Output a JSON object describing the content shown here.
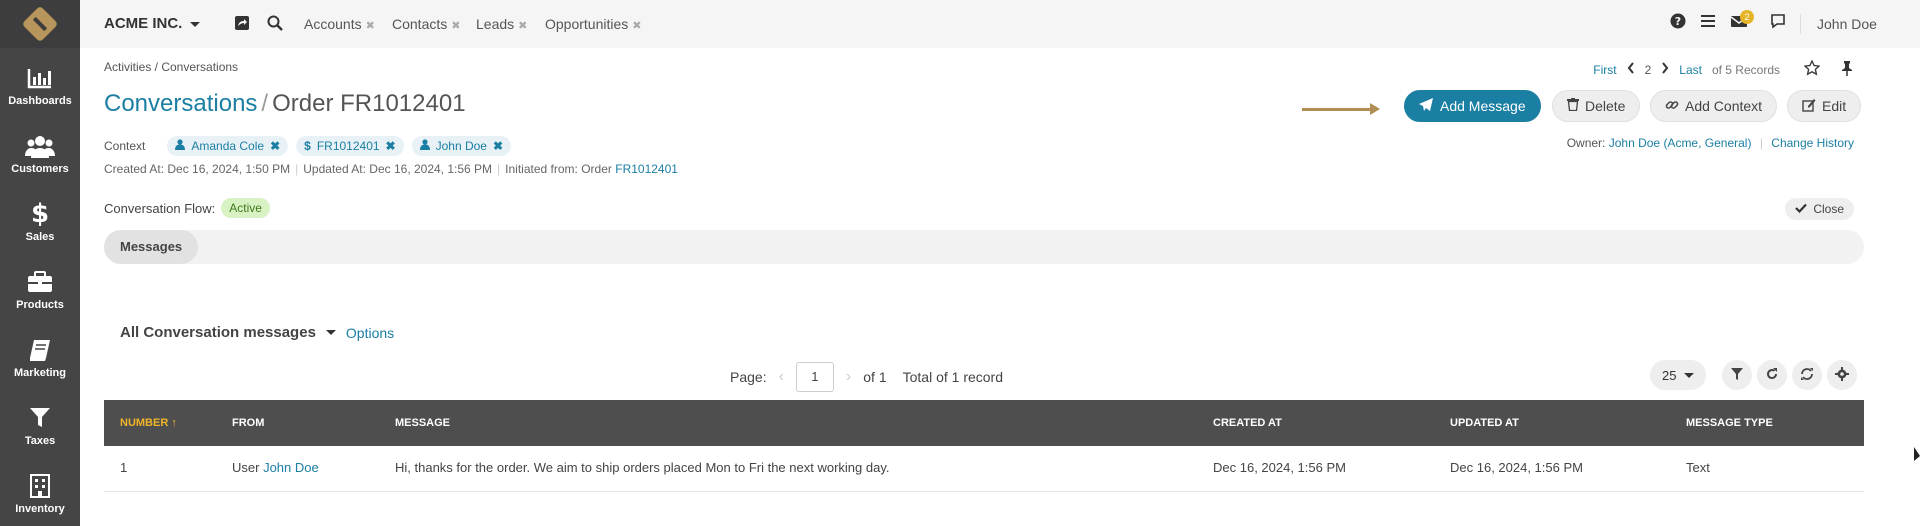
{
  "colors": {
    "accent": "#1b7fa3",
    "sidebar": "#454545",
    "badge": "#e5b427",
    "active_status": "#d9f2c4",
    "table_header": "#4e4e4e",
    "sort_highlight": "#f0b429"
  },
  "topbar": {
    "org_name": "ACME INC.",
    "tabs": [
      {
        "label": "Accounts"
      },
      {
        "label": "Contacts"
      },
      {
        "label": "Leads"
      },
      {
        "label": "Opportunities"
      }
    ],
    "tab_close": "✖",
    "notifications_count": "2",
    "user_name": "John Doe"
  },
  "sidebar": {
    "items": [
      {
        "label": "Dashboards",
        "icon": "bar-chart-icon"
      },
      {
        "label": "Customers",
        "icon": "users-icon"
      },
      {
        "label": "Sales",
        "icon": "dollar-icon"
      },
      {
        "label": "Products",
        "icon": "briefcase-icon"
      },
      {
        "label": "Marketing",
        "icon": "book-icon"
      },
      {
        "label": "Taxes",
        "icon": "filter-icon"
      },
      {
        "label": "Inventory",
        "icon": "building-icon"
      }
    ]
  },
  "page": {
    "breadcrumb": "Activities / Conversations",
    "title_parent": "Conversations",
    "title_separator": "/",
    "title_record": "Order FR1012401",
    "pager": {
      "first": "First",
      "current": "2",
      "last": "Last",
      "summary": "of 5 Records"
    },
    "actions": {
      "add_message": "Add Message",
      "delete": "Delete",
      "add_context": "Add Context",
      "edit": "Edit"
    },
    "context_label": "Context",
    "context_items": [
      {
        "label": "Amanda Cole",
        "icon": "user-icon"
      },
      {
        "label": "FR1012401",
        "icon": "dollar-icon"
      },
      {
        "label": "John Doe",
        "icon": "user-icon"
      }
    ],
    "owner_label": "Owner:",
    "owner_value": "John Doe (Acme, General)",
    "change_history": "Change History",
    "created_at": "Created At: Dec 16, 2024, 1:50 PM",
    "updated_at": "Updated At: Dec 16, 2024, 1:56 PM",
    "initiated_label": "Initiated from: Order",
    "initiated_link": "FR1012401",
    "flow_label": "Conversation Flow:",
    "flow_status": "Active",
    "close_label": "Close",
    "tab_messages": "Messages"
  },
  "grid": {
    "title": "All Conversation messages",
    "options": "Options",
    "page_label": "Page:",
    "page_value": "1",
    "of_pages": "of 1",
    "total": "Total of 1 record",
    "per_page": "25",
    "columns": [
      "NUMBER",
      "FROM",
      "MESSAGE",
      "CREATED AT",
      "UPDATED AT",
      "MESSAGE TYPE"
    ],
    "sort_indicator": "↑",
    "rows": [
      {
        "number": "1",
        "from_prefix": "User",
        "from_name": "John Doe",
        "message": "Hi, thanks for the order. We aim to ship orders placed Mon to Fri the next working day.",
        "created_at": "Dec 16, 2024, 1:56 PM",
        "updated_at": "Dec 16, 2024, 1:56 PM",
        "type": "Text"
      }
    ]
  }
}
